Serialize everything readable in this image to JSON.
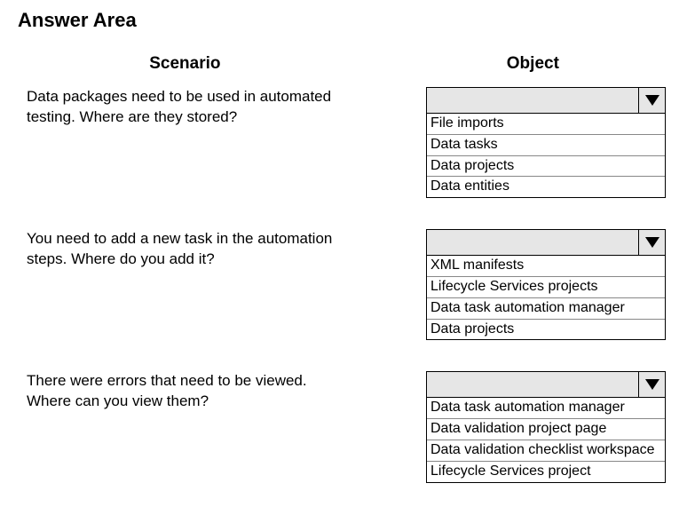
{
  "title": "Answer Area",
  "headers": {
    "scenario": "Scenario",
    "object": "Object"
  },
  "rows": [
    {
      "scenario": "Data packages need to be used in automated testing. Where are they stored?",
      "selected": "",
      "options": [
        "File imports",
        "Data tasks",
        "Data projects",
        "Data entities"
      ]
    },
    {
      "scenario": "You need to add a new task in the automation steps. Where do you add it?",
      "selected": "",
      "options": [
        "XML manifests",
        "Lifecycle Services projects",
        "Data task automation manager",
        "Data projects"
      ]
    },
    {
      "scenario": "There were errors that need to be viewed. Where can you view them?",
      "selected": "",
      "options": [
        "Data task automation  manager",
        "Data validation project page",
        "Data validation checklist workspace",
        "Lifecycle Services project"
      ]
    }
  ]
}
